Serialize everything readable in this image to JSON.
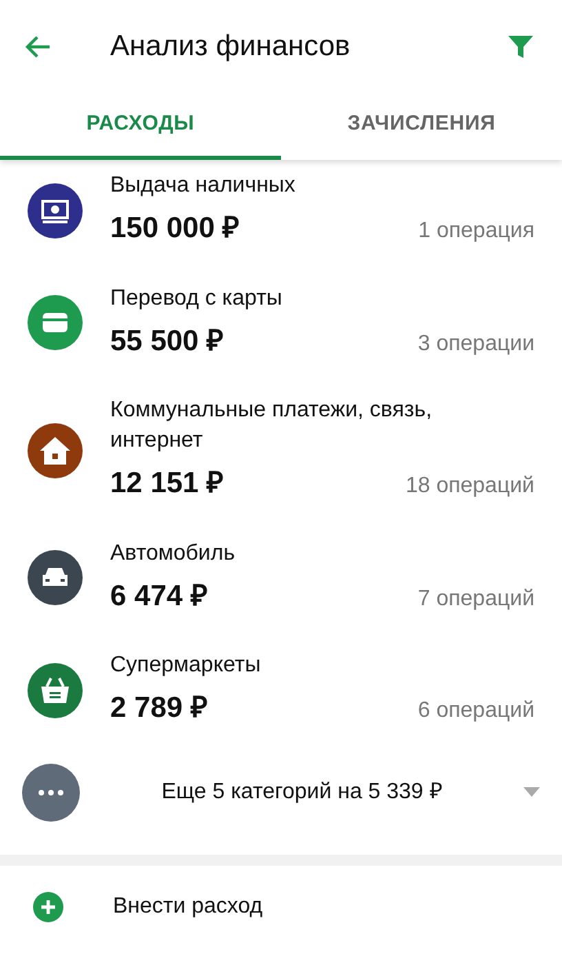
{
  "header": {
    "title": "Анализ финансов"
  },
  "tabs": [
    {
      "label": "РАСХОДЫ",
      "selected": true
    },
    {
      "label": "ЗАЧИСЛЕНИЯ",
      "selected": false
    }
  ],
  "categories": [
    {
      "kind": "cash",
      "color": "#2e2f8c",
      "name": "Выдача наличных",
      "amount": "150 000 ₽",
      "count": "1 операция"
    },
    {
      "kind": "card",
      "color": "#1f9b50",
      "name": "Перевод с карты",
      "amount": "55 500 ₽",
      "count": "3 операции"
    },
    {
      "kind": "home",
      "color": "#8e3a0c",
      "name": "Коммунальные платежи, связь, интернет",
      "amount": "12 151 ₽",
      "count": "18 операций"
    },
    {
      "kind": "car",
      "color": "#3c4650",
      "name": "Автомобиль",
      "amount": "6 474 ₽",
      "count": "7 операций"
    },
    {
      "kind": "basket",
      "color": "#1b7a40",
      "name": "Супермаркеты",
      "amount": "2 789 ₽",
      "count": "6 операций"
    }
  ],
  "more": {
    "label": "Еще 5 категорий на 5 339 ₽",
    "expanded": false
  },
  "add": {
    "label": "Внести расход"
  }
}
